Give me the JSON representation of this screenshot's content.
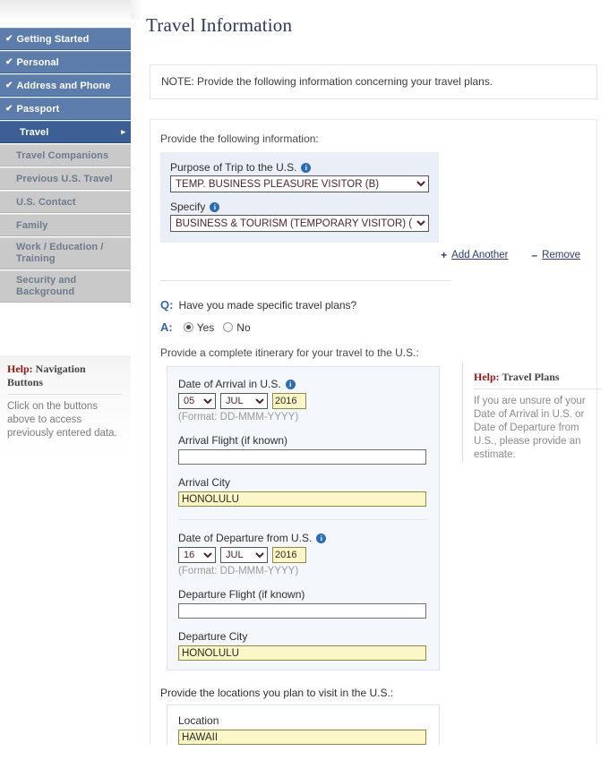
{
  "page": {
    "title": "Travel Information",
    "note": "NOTE: Provide the following information concerning your travel plans."
  },
  "colors": {
    "nav_done": "#5c7cab",
    "nav_active": "#3c5f95",
    "nav_todo": "#c9c9c9",
    "panel_blue": "#eaeff7",
    "autofill_yellow": "#fbf7c9",
    "help_accent": "#8c1c13",
    "qa_accent": "#3a63a8",
    "title_color": "#2c3a5a"
  },
  "sidebar": {
    "items": [
      {
        "label": "Getting Started",
        "state": "done",
        "icon": "check-icon"
      },
      {
        "label": "Personal",
        "state": "done",
        "icon": "check-icon"
      },
      {
        "label": "Address and Phone",
        "state": "done",
        "icon": "check-icon"
      },
      {
        "label": "Passport",
        "state": "done",
        "icon": "check-icon"
      },
      {
        "label": "Travel",
        "state": "active",
        "icon": "chevron-right-icon"
      },
      {
        "label": "Travel Companions",
        "state": "todo"
      },
      {
        "label": "Previous U.S. Travel",
        "state": "todo"
      },
      {
        "label": "U.S. Contact",
        "state": "todo"
      },
      {
        "label": "Family",
        "state": "todo"
      },
      {
        "label": "Work / Education / Training",
        "state": "todo"
      },
      {
        "label": "Security and Background",
        "state": "todo"
      }
    ],
    "help": {
      "prefix": "Help:",
      "topic": " Navigation Buttons",
      "body": "Click on the buttons above to access previously entered data."
    }
  },
  "purpose_section": {
    "lead": "Provide the following information:",
    "purpose_label": "Purpose of Trip to the U.S.",
    "purpose_value": "TEMP. BUSINESS PLEASURE VISITOR (B)",
    "specify_label": "Specify",
    "specify_value": "BUSINESS & TOURISM (TEMPORARY VISITOR) (B1/",
    "add_another": "Add Another",
    "add_another_sign": "+",
    "remove": "Remove",
    "remove_sign": "–",
    "info_icon_glyph": "i"
  },
  "travel_plans": {
    "q_key": "Q:",
    "question": "Have you made specific travel plans?",
    "a_key": "A:",
    "yes_label": "Yes",
    "no_label": "No",
    "selected": "Yes",
    "itinerary_lead": "Provide a complete itinerary for your travel to the U.S.:"
  },
  "arrival": {
    "date_label": "Date of Arrival in U.S.",
    "day": "05",
    "month": "JUL",
    "year": "2016",
    "format_hint": "(Format: DD-MMM-YYYY)",
    "flight_label": "Arrival Flight (if known)",
    "flight_value": "",
    "city_label": "Arrival City",
    "city_value": "HONOLULU"
  },
  "departure": {
    "date_label": "Date of Departure from U.S.",
    "day": "16",
    "month": "JUL",
    "year": "2016",
    "format_hint": "(Format: DD-MMM-YYYY)",
    "flight_label": "Departure Flight (if known)",
    "flight_value": "",
    "city_label": "Departure City",
    "city_value": "HONOLULU"
  },
  "locations": {
    "lead": "Provide the locations you plan to visit in the U.S.:",
    "location_label": "Location",
    "location_value": "HAWAII"
  },
  "right_help": {
    "prefix": "Help:",
    "topic": " Travel Plans",
    "body": "If you are unsure of your Date of Arrival in U.S. or Date of Departure from U.S., please provide an estimate."
  }
}
